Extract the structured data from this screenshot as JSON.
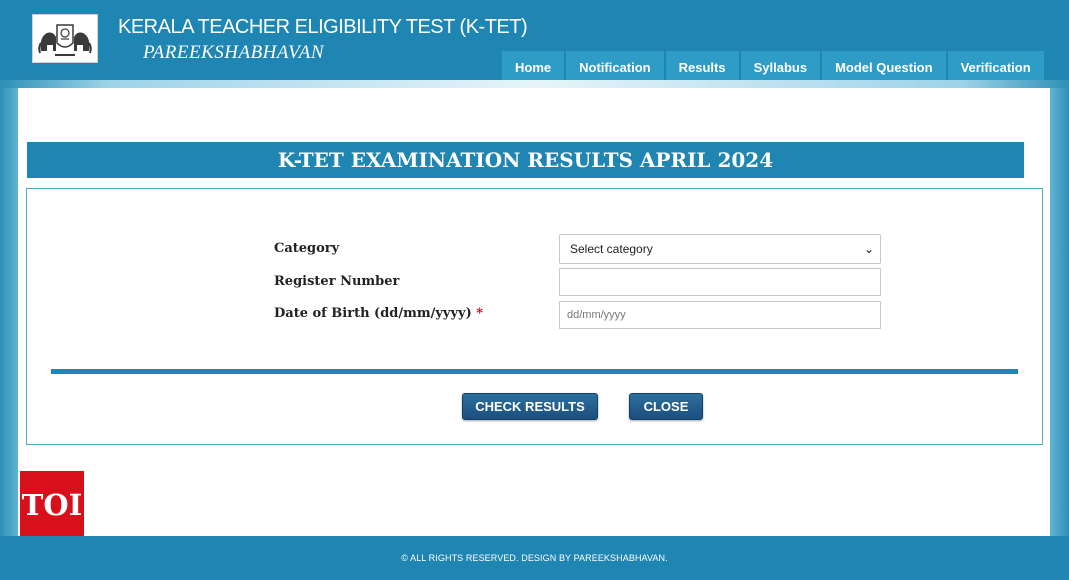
{
  "header": {
    "title": "KERALA TEACHER ELIGIBILITY TEST (K-TET)",
    "subtitle": "PAREEKSHABHAVAN",
    "logo_icon": "kerala-emblem-icon"
  },
  "nav": {
    "items": [
      {
        "label": "Home"
      },
      {
        "label": "Notification"
      },
      {
        "label": "Results"
      },
      {
        "label": "Syllabus"
      },
      {
        "label": "Model Question"
      },
      {
        "label": "Verification"
      }
    ]
  },
  "banner": {
    "title": "K-TET EXAMINATION RESULTS APRIL 2024"
  },
  "form": {
    "category_label": "Category",
    "category_selected": "Select category",
    "register_label": "Register Number",
    "register_value": "",
    "dob_label": "Date of Birth (dd/mm/yyyy)",
    "dob_required_mark": "*",
    "dob_placeholder": "dd/mm/yyyy"
  },
  "buttons": {
    "check_results": "CHECK RESULTS",
    "close": "CLOSE"
  },
  "watermark": {
    "text": "TOI"
  },
  "footer": {
    "text": "© ALL RIGHTS RESERVED. DESIGN BY PAREEKSHABHAVAN."
  },
  "colors": {
    "primary": "#1f85b2",
    "nav_item": "#2f9bc7",
    "button": "#1b4f7e",
    "required": "#d0021b",
    "watermark": "#d7101c"
  }
}
